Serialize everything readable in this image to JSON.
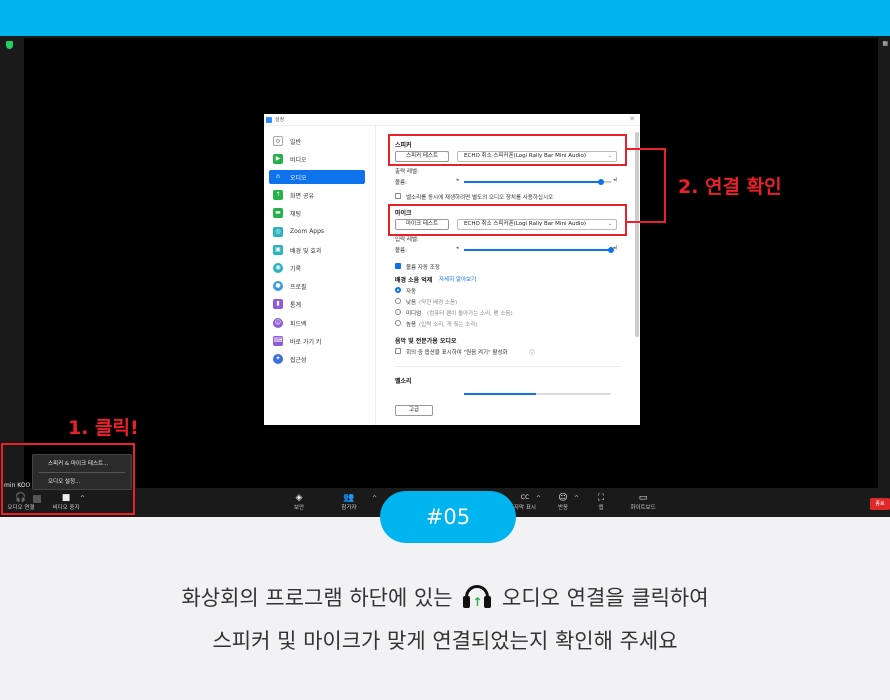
{
  "zoom": {
    "participant_name": "min KOO",
    "toolbar": {
      "audio": "오디오 연결",
      "video": "비디오 중지",
      "security": "보안",
      "participants": "참가자",
      "captions": "자막 표시",
      "reactions": "반응",
      "apps": "앱",
      "whiteboard": "화이트보드",
      "end": "종료"
    },
    "audio_menu": [
      "스피커 & 마이크 테스트...",
      "오디오 설정..."
    ]
  },
  "settings": {
    "title": "설정",
    "sidebar": [
      {
        "label": "일반",
        "icon": "gear-icon"
      },
      {
        "label": "비디오",
        "icon": "video-icon"
      },
      {
        "label": "오디오",
        "icon": "headphones-icon",
        "active": true
      },
      {
        "label": "화면 공유",
        "icon": "share-screen-icon"
      },
      {
        "label": "채팅",
        "icon": "chat-icon"
      },
      {
        "label": "Zoom Apps",
        "icon": "apps-icon"
      },
      {
        "label": "배경 및 효과",
        "icon": "background-icon"
      },
      {
        "label": "기록",
        "icon": "record-icon"
      },
      {
        "label": "프로필",
        "icon": "profile-icon"
      },
      {
        "label": "통계",
        "icon": "statistics-icon"
      },
      {
        "label": "피드백",
        "icon": "feedback-icon"
      },
      {
        "label": "바로 가기 키",
        "icon": "keyboard-icon"
      },
      {
        "label": "접근성",
        "icon": "accessibility-icon"
      }
    ],
    "speaker": {
      "heading": "스피커",
      "test_button": "스피커 테스트",
      "device": "ECHO 취소 스피커폰(Logi Rally Bar Mini Audio)",
      "output_level": "출력 레벨:",
      "volume_label": "볼륨:",
      "volume": 0.93
    },
    "ring_separate": "벨소리를 동시에 재생하려면 별도의 오디오 장치를 사용하십시오",
    "mic": {
      "heading": "마이크",
      "test_button": "마이크 테스트",
      "device": "ECHO 취소 스피커폰(Logi Rally Bar Mini Audio)",
      "input_level": "입력 레벨:",
      "volume_label": "볼륨:",
      "volume": 1.0
    },
    "auto_volume": "볼륨 자동 조정",
    "noise": {
      "heading": "배경 소음 억제",
      "learn_more": "자세히 알아보기",
      "options": [
        {
          "label": "자동",
          "desc": "",
          "selected": true
        },
        {
          "label": "낮음",
          "desc": "(약한 배경 소음)"
        },
        {
          "label": "미디엄",
          "desc": "(컴퓨터 팬이 돌아가는 소리, 펜 소음)"
        },
        {
          "label": "높음",
          "desc": "(입력 소리, 개 짖는 소리)"
        }
      ]
    },
    "music": {
      "heading": "음악 및 전문가용 오디오",
      "option": "회의 중 옵션을 표시하여 \"원음 켜기\" 활성화"
    },
    "ringtone_heading": "벨소리",
    "advanced_button": "고급"
  },
  "annotations": {
    "step1": "1. 클릭!",
    "step2": "2. 연결 확인"
  },
  "badge": "#05",
  "caption": {
    "line1_before": "화상회의 프로그램 하단에 있는",
    "line1_after": "오디오 연결을 클릭하여",
    "line2": "스피커 및 마이크가 맞게 연결되었는지 확인해 주세요"
  },
  "colors": {
    "accent": "#00b4ef",
    "annotation": "#e8212b",
    "zoom_blue": "#0e72ed"
  }
}
